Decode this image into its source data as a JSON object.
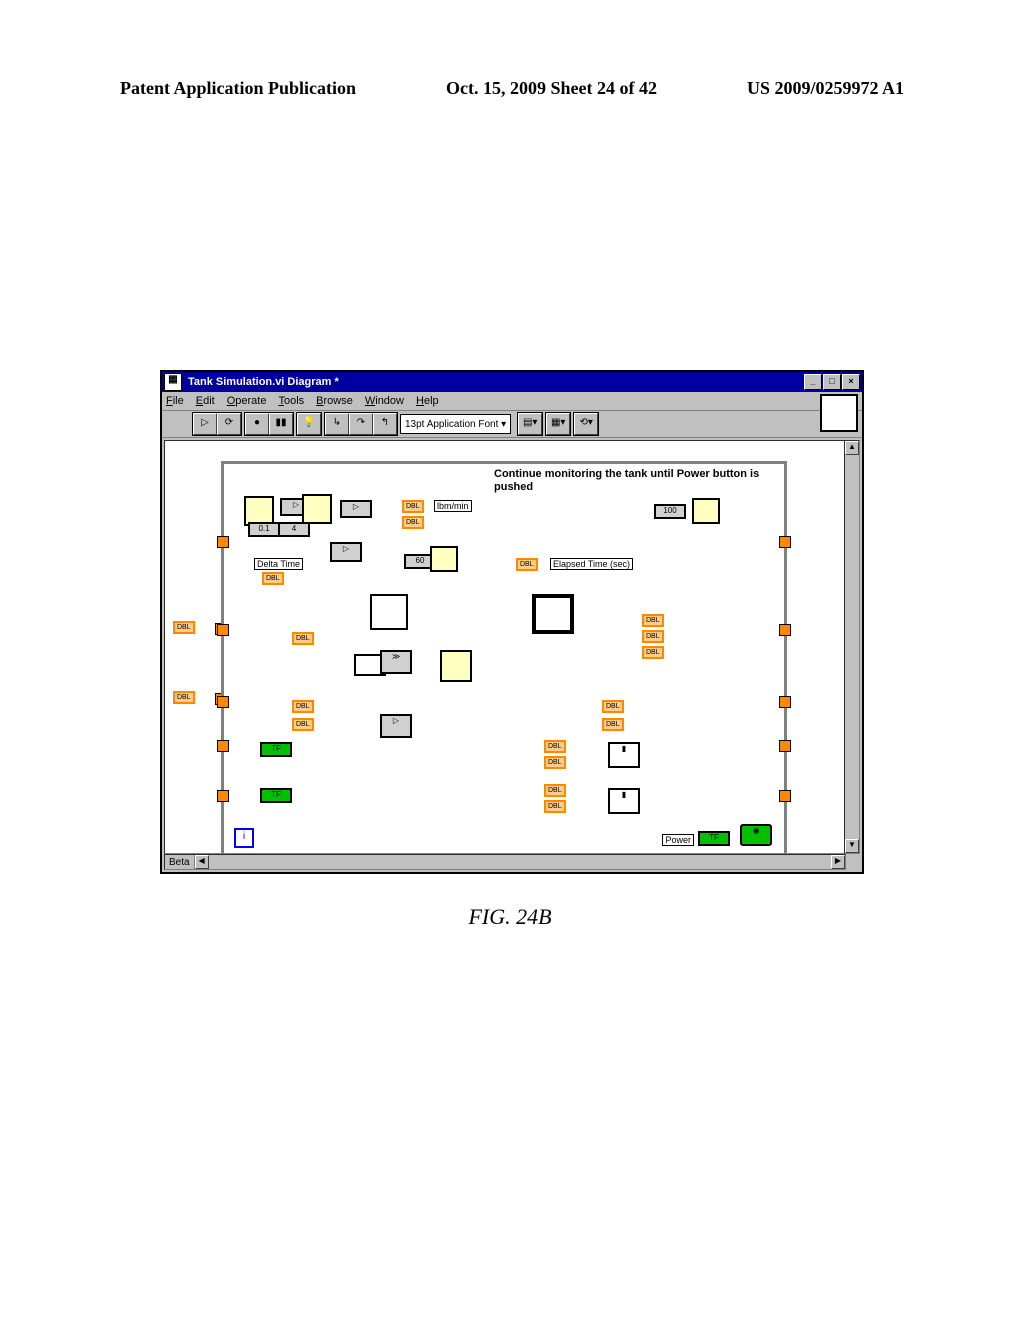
{
  "header": {
    "left": "Patent Application Publication",
    "center": "Oct. 15, 2009  Sheet 24 of 42",
    "right": "US 2009/0259972 A1"
  },
  "window": {
    "title": "Tank Simulation.vi Diagram *"
  },
  "menubar": {
    "file": "File",
    "edit": "Edit",
    "operate": "Operate",
    "tools": "Tools",
    "browse": "Browse",
    "window": "Window",
    "help": "Help"
  },
  "toolbar": {
    "font": "13pt Application Font"
  },
  "diagram": {
    "comment": "Continue monitoring the tank until Power button is pushed",
    "lbm_min": "lbm/min",
    "elapsed": "Elapsed Time (sec)",
    "delta_time": "Delta Time",
    "power": "Power",
    "iteration": "i",
    "dbl": "DBL",
    "tf": "TF",
    "val_01": "0.1",
    "val_4": "4",
    "val_60": "60",
    "val_100": "100"
  },
  "statusbar": {
    "label": "Beta"
  },
  "figure": {
    "caption": "FIG. 24B"
  }
}
